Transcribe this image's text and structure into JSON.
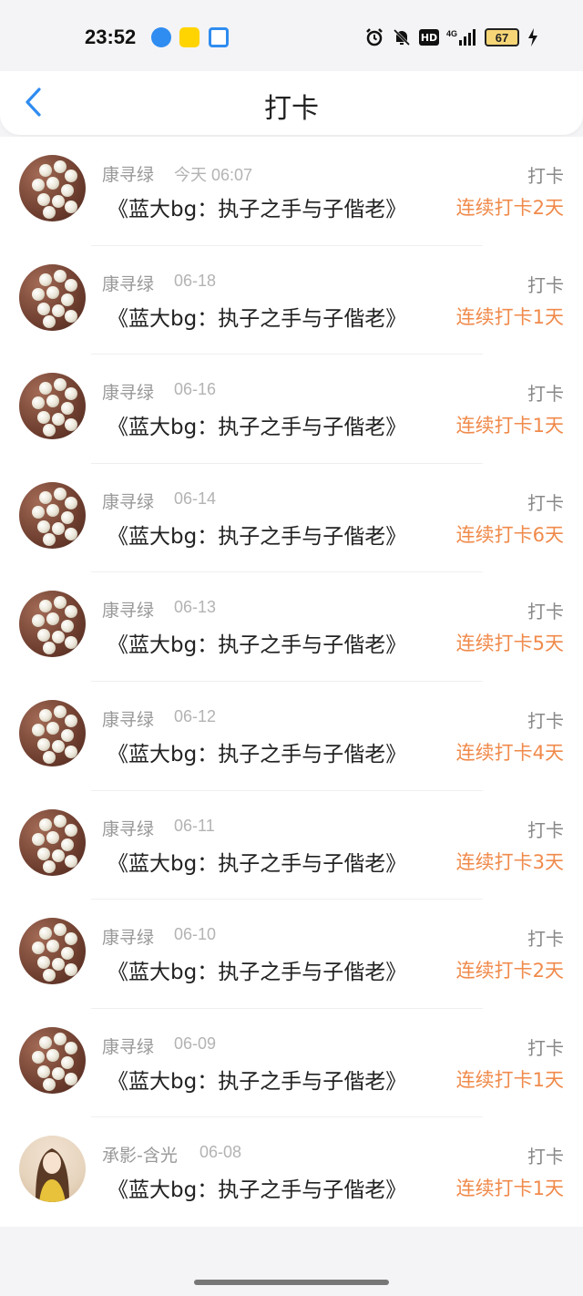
{
  "status_bar": {
    "time": "23:52",
    "network": "4G",
    "battery": "67",
    "hd_label": "HD"
  },
  "header": {
    "title": "打卡",
    "back_icon": "chevron-left-icon"
  },
  "colors": {
    "accent": "#2f8cf0",
    "streak": "#f08a4b"
  },
  "checkins": [
    {
      "user": "康寻绿",
      "date": "今天 06:07",
      "book": "《蓝大bg：执子之手与子偕老》",
      "tag": "打卡",
      "streak": "连续打卡2天",
      "avatar": "pearl"
    },
    {
      "user": "康寻绿",
      "date": "06-18",
      "book": "《蓝大bg：执子之手与子偕老》",
      "tag": "打卡",
      "streak": "连续打卡1天",
      "avatar": "pearl"
    },
    {
      "user": "康寻绿",
      "date": "06-16",
      "book": "《蓝大bg：执子之手与子偕老》",
      "tag": "打卡",
      "streak": "连续打卡1天",
      "avatar": "pearl"
    },
    {
      "user": "康寻绿",
      "date": "06-14",
      "book": "《蓝大bg：执子之手与子偕老》",
      "tag": "打卡",
      "streak": "连续打卡6天",
      "avatar": "pearl"
    },
    {
      "user": "康寻绿",
      "date": "06-13",
      "book": "《蓝大bg：执子之手与子偕老》",
      "tag": "打卡",
      "streak": "连续打卡5天",
      "avatar": "pearl"
    },
    {
      "user": "康寻绿",
      "date": "06-12",
      "book": "《蓝大bg：执子之手与子偕老》",
      "tag": "打卡",
      "streak": "连续打卡4天",
      "avatar": "pearl"
    },
    {
      "user": "康寻绿",
      "date": "06-11",
      "book": "《蓝大bg：执子之手与子偕老》",
      "tag": "打卡",
      "streak": "连续打卡3天",
      "avatar": "pearl"
    },
    {
      "user": "康寻绿",
      "date": "06-10",
      "book": "《蓝大bg：执子之手与子偕老》",
      "tag": "打卡",
      "streak": "连续打卡2天",
      "avatar": "pearl"
    },
    {
      "user": "康寻绿",
      "date": "06-09",
      "book": "《蓝大bg：执子之手与子偕老》",
      "tag": "打卡",
      "streak": "连续打卡1天",
      "avatar": "pearl"
    },
    {
      "user": "承影-含光",
      "date": "06-08",
      "book": "《蓝大bg：执子之手与子偕老》",
      "tag": "打卡",
      "streak": "连续打卡1天",
      "avatar": "girl"
    }
  ]
}
